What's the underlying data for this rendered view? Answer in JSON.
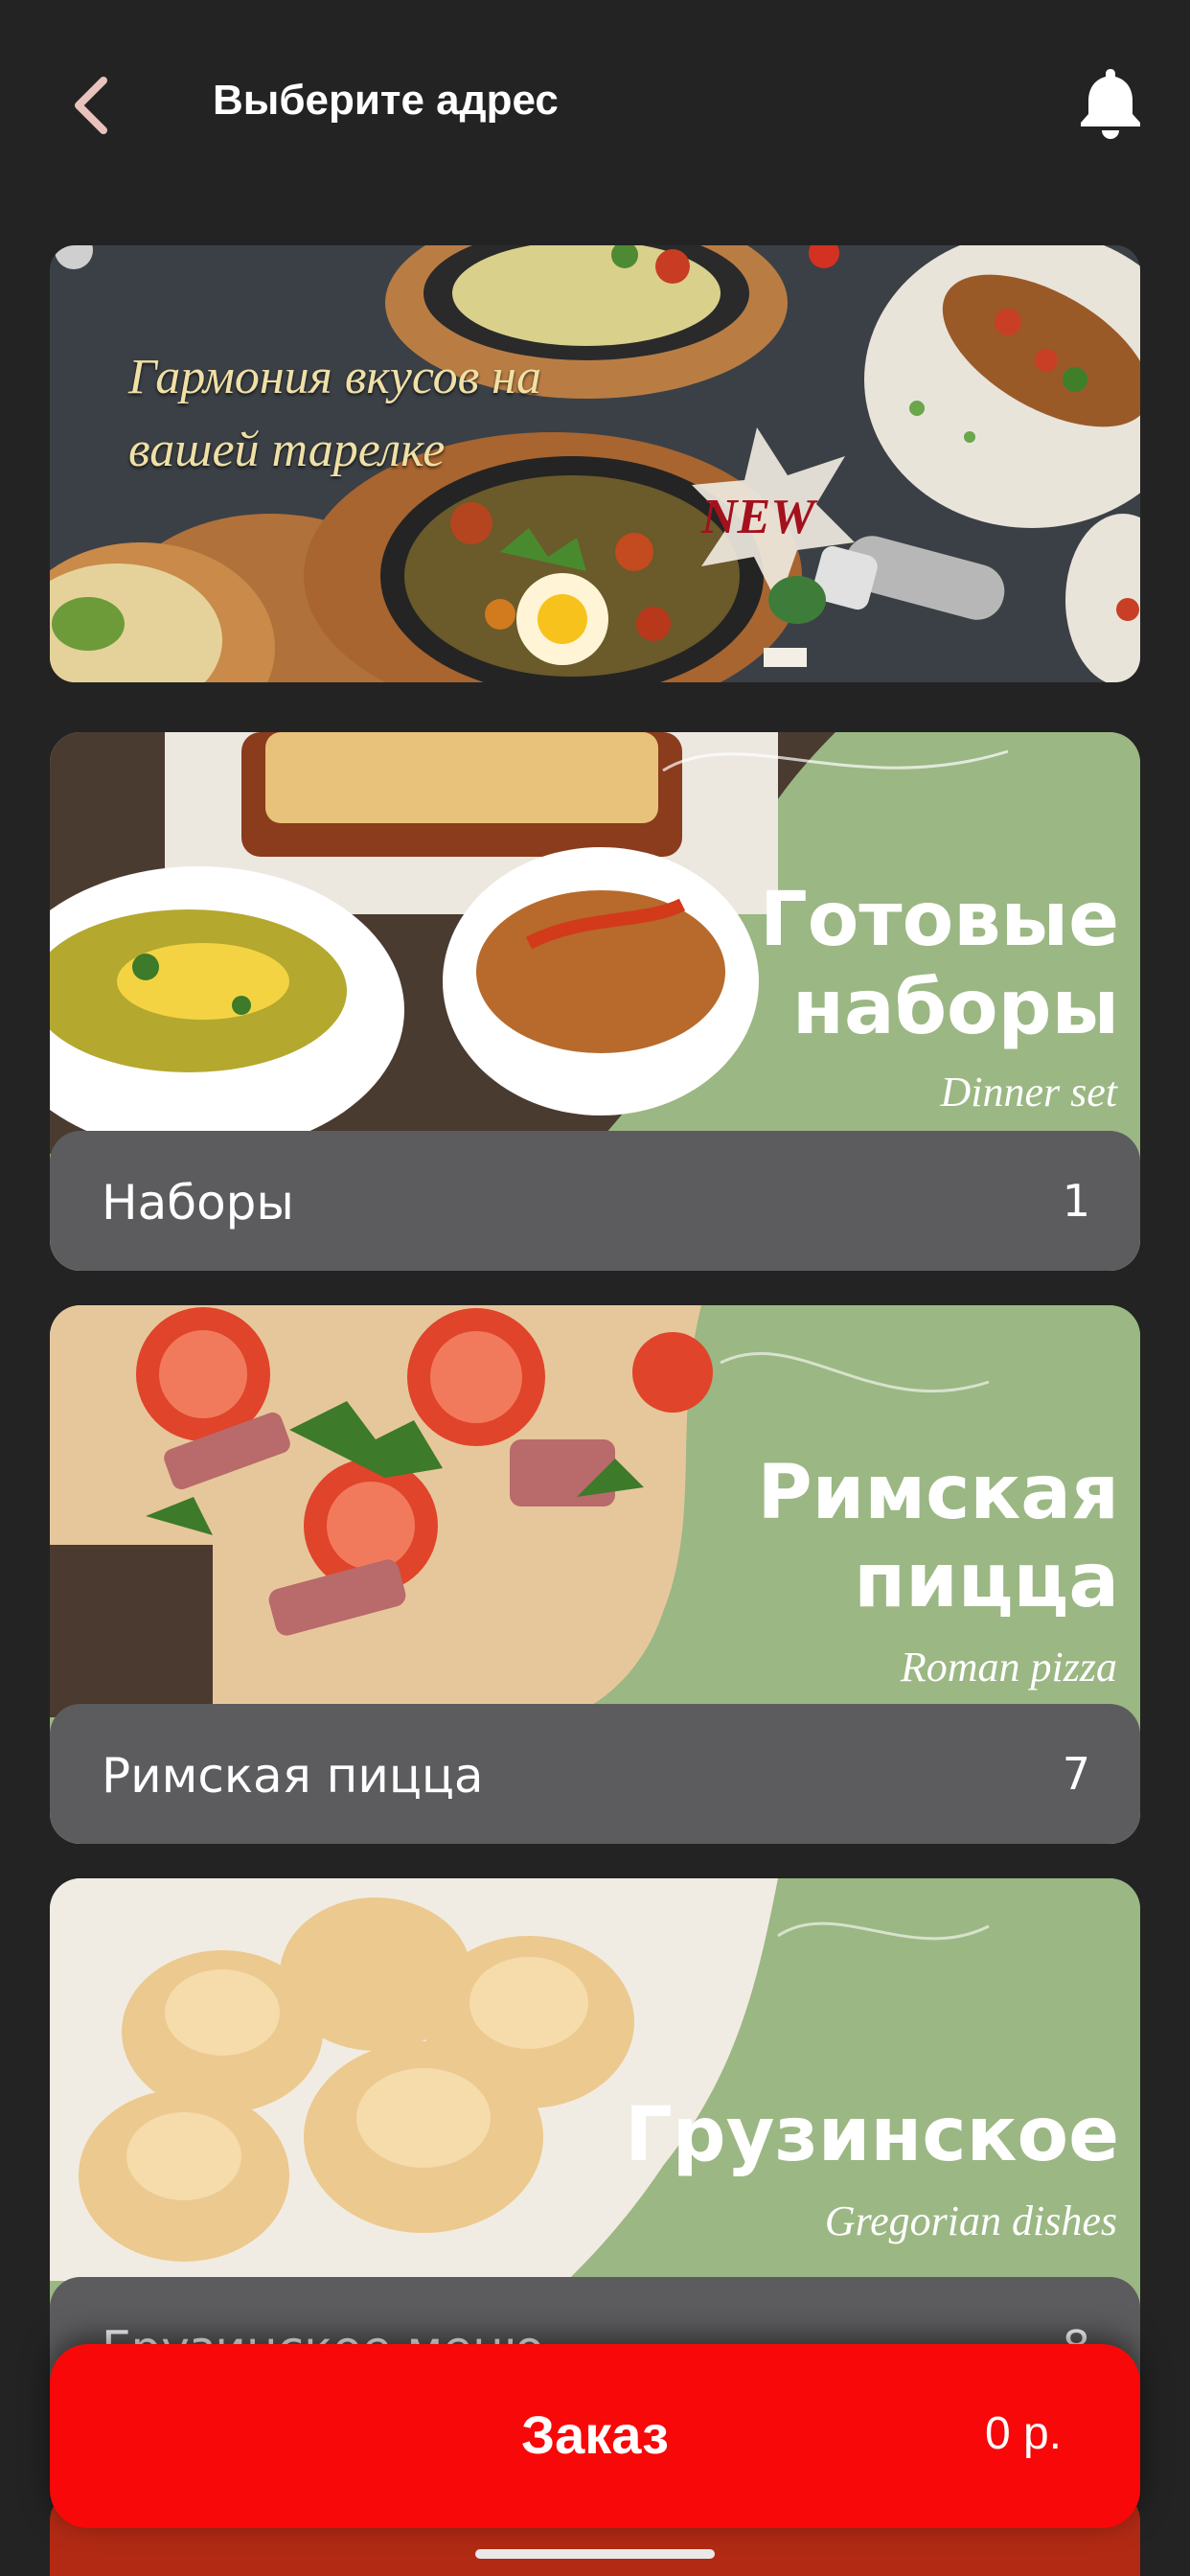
{
  "header": {
    "title": "Выберите адрес",
    "icons": {
      "back": "chevron-left-icon",
      "notifications": "bell-icon"
    }
  },
  "promo": {
    "headline": "Гармония вкусов на вашей тарелке",
    "badge": "NEW"
  },
  "categories": [
    {
      "title_line1": "Готовые",
      "title_line2": "наборы",
      "subtitle": "Dinner set",
      "name": "Наборы",
      "count": "1"
    },
    {
      "title_line1": "Римская",
      "title_line2": "пицца",
      "subtitle": "Roman pizza",
      "name": "Римская пицца",
      "count": "7"
    },
    {
      "title_line1": "Грузинское",
      "title_line2": "",
      "subtitle": "Gregorian dishes",
      "name": "Грузинское меню",
      "count": "8"
    }
  ],
  "order": {
    "label": "Заказ",
    "total": "0 р."
  },
  "colors": {
    "background": "#232323",
    "accent": "#f80808",
    "card_green": "#9bb783",
    "bar_grey": "#5c5c5e"
  }
}
